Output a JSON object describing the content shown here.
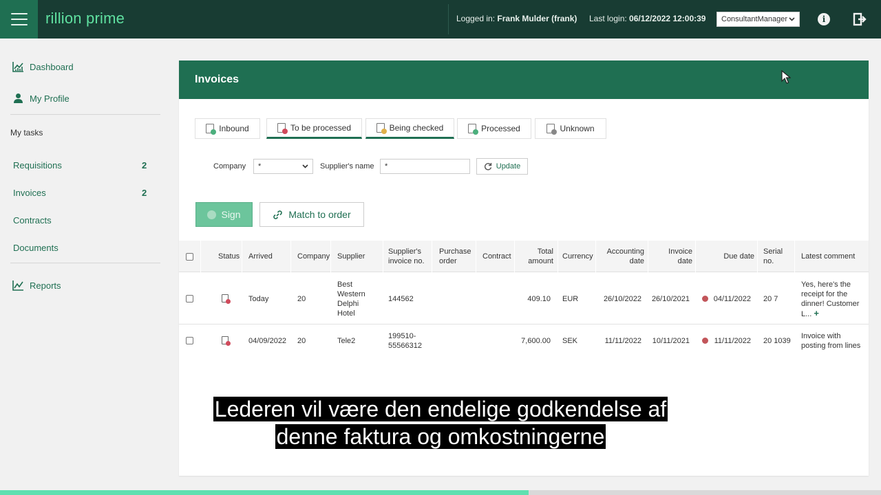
{
  "app": {
    "logo": "rillion prime"
  },
  "header": {
    "logged_in_label": "Logged in:",
    "logged_in_user": "Frank Mulder (frank)",
    "last_login_label": "Last login:",
    "last_login_value": "06/12/2022 12:00:39",
    "role": "ConsultantManager",
    "icons": [
      "menu-icon",
      "info-icon",
      "logout-icon"
    ]
  },
  "sidebar": {
    "dashboard": "Dashboard",
    "my_profile": "My Profile",
    "my_tasks": "My tasks",
    "tasks": [
      {
        "label": "Requisitions",
        "count": "2"
      },
      {
        "label": "Invoices",
        "count": "2"
      },
      {
        "label": "Contracts",
        "count": ""
      },
      {
        "label": "Documents",
        "count": ""
      }
    ],
    "reports": "Reports"
  },
  "panel": {
    "title": "Invoices",
    "tabs": [
      {
        "label": "Inbound",
        "active": false,
        "dot": "#4caf7d"
      },
      {
        "label": "To be processed",
        "active": true,
        "dot": "#d04a5b"
      },
      {
        "label": "Being checked",
        "active": true,
        "dot": "#e0b04a"
      },
      {
        "label": "Processed",
        "active": false,
        "dot": "#4caf7d"
      },
      {
        "label": "Unknown",
        "active": false,
        "dot": "#888888"
      }
    ],
    "filters": {
      "company_label": "Company",
      "company_value": "*",
      "supplier_label": "Supplier's name",
      "supplier_value": "*",
      "update_label": "Update"
    },
    "actions": {
      "sign_label": "Sign",
      "match_label": "Match to order"
    }
  },
  "table": {
    "headers": {
      "status": "Status",
      "arrived": "Arrived",
      "company": "Company",
      "supplier": "Supplier",
      "supplier_invoice_no_1": "Supplier's",
      "supplier_invoice_no_2": "invoice no.",
      "purchase_order_1": "Purchase",
      "purchase_order_2": "order",
      "contract": "Contract",
      "total_amount_1": "Total",
      "total_amount_2": "amount",
      "currency": "Currency",
      "accounting_date_1": "Accounting",
      "accounting_date_2": "date",
      "invoice_date_1": "Invoice",
      "invoice_date_2": "date",
      "due_date": "Due date",
      "serial_no_1": "Serial",
      "serial_no_2": "no.",
      "latest_comment": "Latest comment"
    },
    "rows": [
      {
        "arrived": "Today",
        "company": "20",
        "supplier_lines": [
          "Best",
          "Western",
          "Delphi",
          "Hotel"
        ],
        "supplier_invoice_no": "144562",
        "purchase_order": "",
        "contract": "",
        "total_amount": "409.10",
        "currency": "EUR",
        "accounting_date": "26/10/2022",
        "invoice_date": "26/10/2021",
        "due_date": "04/11/2022",
        "serial_no": "20 7",
        "comment_lines": [
          "Yes, here's the",
          "receipt for the",
          "dinner! Customer",
          "L..."
        ]
      },
      {
        "arrived": "04/09/2022",
        "company": "20",
        "supplier_lines": [
          "Tele2"
        ],
        "supplier_invoice_no_lines": [
          "199510-",
          "55566312"
        ],
        "purchase_order": "",
        "contract": "",
        "total_amount": "7,600.00",
        "currency": "SEK",
        "accounting_date": "11/11/2022",
        "invoice_date": "10/11/2021",
        "due_date": "11/11/2022",
        "serial_no": "20 1039",
        "comment_lines": [
          "Invoice with",
          "posting from lines"
        ]
      }
    ]
  },
  "subtitle": {
    "line1": "Lederen vil være den endelige godkendelse af",
    "line2": "denne faktura og omkostningerne"
  },
  "video_progress": 0.6,
  "colors": {
    "dark_green": "#183c33",
    "brand_green": "#1f6f52",
    "accent_mint": "#5fe0a0"
  }
}
